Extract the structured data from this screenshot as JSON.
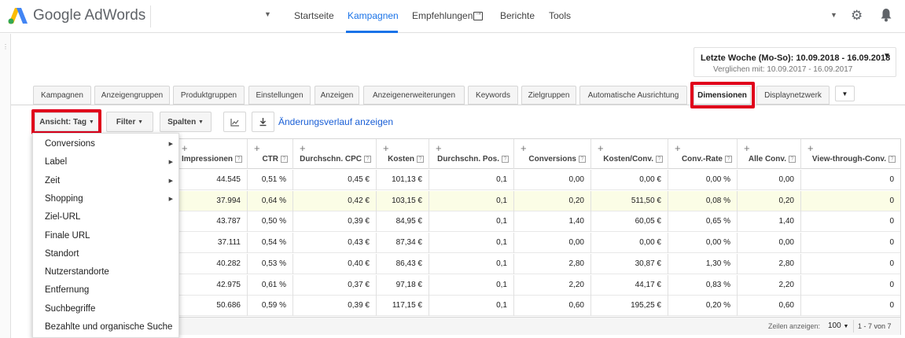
{
  "app": {
    "brand": "Google AdWords",
    "nav": [
      {
        "label": "Startseite",
        "active": false
      },
      {
        "label": "Kampagnen",
        "active": true
      },
      {
        "label": "Empfehlungen",
        "active": false
      },
      {
        "label": "Berichte",
        "active": false
      },
      {
        "label": "Tools",
        "active": false
      }
    ],
    "accent": "#1a73e8",
    "highlight": "#e0001b"
  },
  "date_range": {
    "main": "Letzte Woche (Mo-So): 10.09.2018 - 16.09.2018",
    "compare": "Verglichen mit: 10.09.2017 - 16.09.2017"
  },
  "tabs": [
    {
      "label": "Kampagnen"
    },
    {
      "label": "Anzeigengruppen"
    },
    {
      "label": "Produktgruppen"
    },
    {
      "label": "Einstellungen"
    },
    {
      "label": "Anzeigen"
    },
    {
      "label": "Anzeigenerweiterungen"
    },
    {
      "label": "Keywords"
    },
    {
      "label": "Zielgruppen"
    },
    {
      "label": "Automatische Ausrichtung"
    },
    {
      "label": "Dimensionen",
      "active": true
    },
    {
      "label": "Displaynetzwerk"
    }
  ],
  "toolbar": {
    "view": "Ansicht: Tag",
    "filter": "Filter",
    "columns": "Spalten",
    "change_history": "Änderungsverlauf anzeigen"
  },
  "table": {
    "columns": [
      "Impressionen",
      "CTR",
      "Durchschn. CPC",
      "Kosten",
      "Durchschn. Pos.",
      "Conversions",
      "Kosten/Conv.",
      "Conv.-Rate",
      "Alle Conv.",
      "View-through-Conv."
    ],
    "rows": [
      [
        "44.545",
        "0,51 %",
        "0,45 €",
        "101,13 €",
        "0,1",
        "0,00",
        "0,00 €",
        "0,00 %",
        "0,00",
        "0"
      ],
      [
        "37.994",
        "0,64 %",
        "0,42 €",
        "103,15 €",
        "0,1",
        "0,20",
        "511,50 €",
        "0,08 %",
        "0,20",
        "0"
      ],
      [
        "43.787",
        "0,50 %",
        "0,39 €",
        "84,95 €",
        "0,1",
        "1,40",
        "60,05 €",
        "0,65 %",
        "1,40",
        "0"
      ],
      [
        "37.111",
        "0,54 %",
        "0,43 €",
        "87,34 €",
        "0,1",
        "0,00",
        "0,00 €",
        "0,00 %",
        "0,00",
        "0"
      ],
      [
        "40.282",
        "0,53 %",
        "0,40 €",
        "86,43 €",
        "0,1",
        "2,80",
        "30,87 €",
        "1,30 %",
        "2,80",
        "0"
      ],
      [
        "42.975",
        "0,61 %",
        "0,37 €",
        "97,18 €",
        "0,1",
        "2,20",
        "44,17 €",
        "0,83 %",
        "2,20",
        "0"
      ],
      [
        "50.686",
        "0,59 %",
        "0,39 €",
        "117,15 €",
        "0,1",
        "0,60",
        "195,25 €",
        "0,20 %",
        "0,60",
        "0"
      ]
    ],
    "footer": {
      "rows_label": "Zeilen anzeigen:",
      "rows_count": "100",
      "range": "1 - 7 von 7"
    }
  },
  "menu": {
    "items": [
      {
        "label": "Conversions",
        "submenu": true
      },
      {
        "label": "Label",
        "submenu": true
      },
      {
        "label": "Zeit",
        "submenu": true
      },
      {
        "label": "Shopping",
        "submenu": true
      },
      {
        "label": "Ziel-URL",
        "submenu": false
      },
      {
        "label": "Finale URL",
        "submenu": false
      },
      {
        "label": "Standort",
        "submenu": false
      },
      {
        "label": "Nutzerstandorte",
        "submenu": false
      },
      {
        "label": "Entfernung",
        "submenu": false
      },
      {
        "label": "Suchbegriffe",
        "submenu": false
      },
      {
        "label": "Bezahlte und organische Suche",
        "submenu": false
      }
    ]
  }
}
